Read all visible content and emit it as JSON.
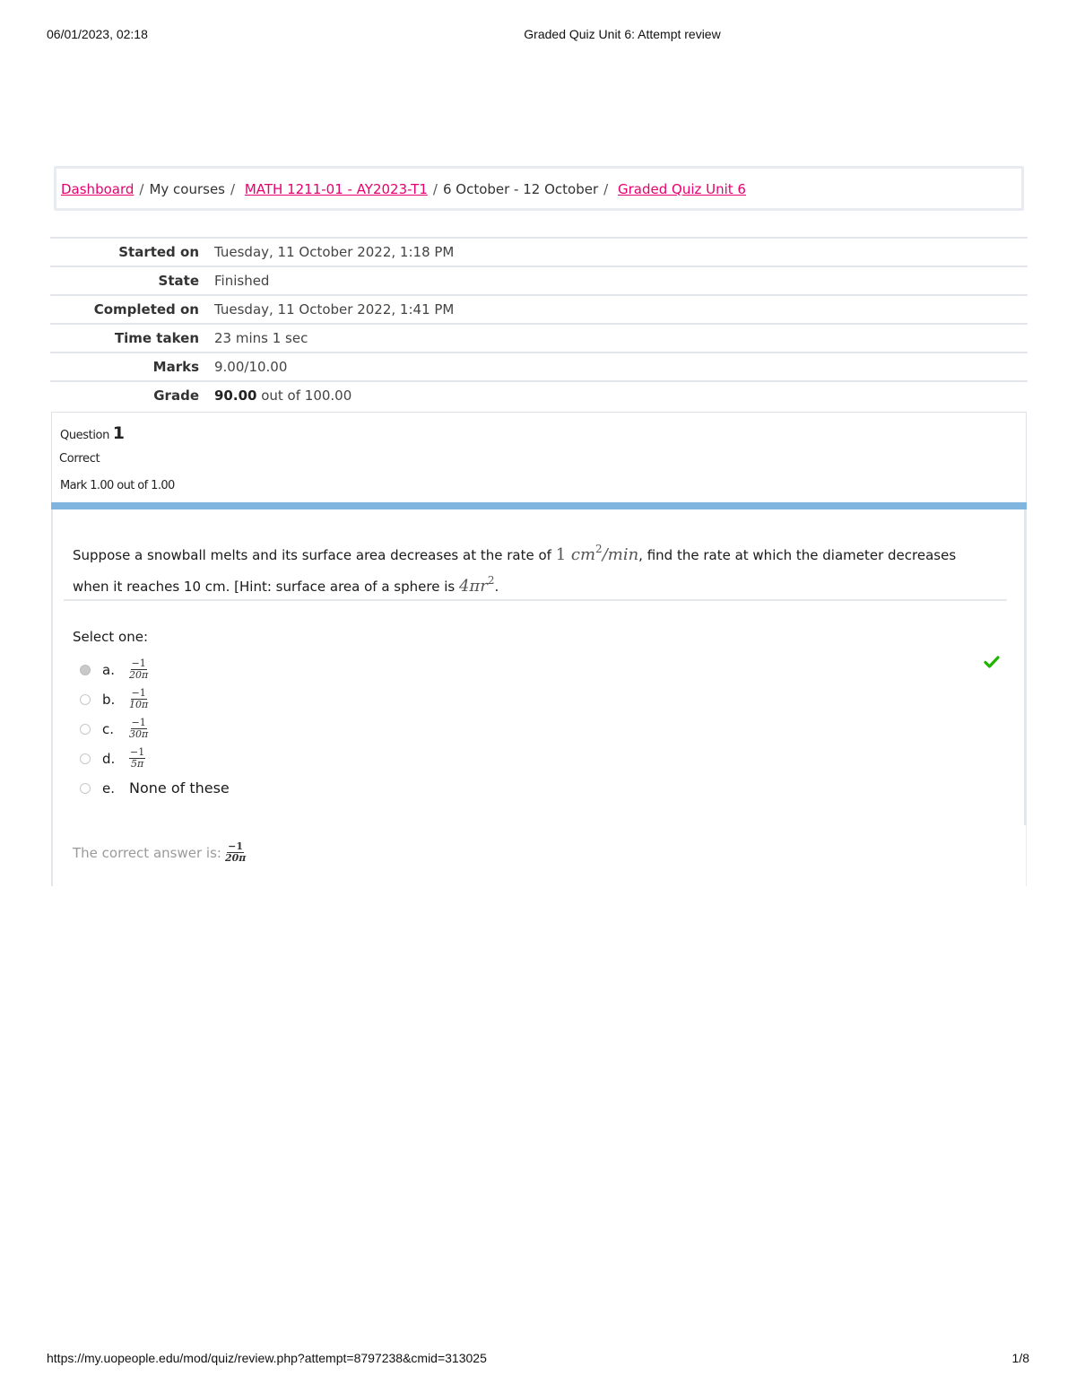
{
  "print_header": {
    "datetime": "06/01/2023, 02:18",
    "title": "Graded Quiz Unit 6: Attempt review"
  },
  "breadcrumb": {
    "items": [
      {
        "label": "Dashboard",
        "link": true
      },
      {
        "label": "My courses",
        "link": false
      },
      {
        "label": "MATH 1211-01 - AY2023-T1",
        "link": true
      },
      {
        "label": "6 October - 12 October",
        "link": false
      },
      {
        "label": "Graded Quiz Unit 6",
        "link": true
      }
    ],
    "separator": "/",
    "link_color": "#e6006f"
  },
  "summary": [
    {
      "label": "Started on",
      "value": "Tuesday, 11 October 2022, 1:18 PM"
    },
    {
      "label": "State",
      "value": "Finished"
    },
    {
      "label": "Completed on",
      "value": "Tuesday, 11 October 2022, 1:41 PM"
    },
    {
      "label": "Time taken",
      "value": "23 mins 1 sec"
    },
    {
      "label": "Marks",
      "value": "9.00/10.00"
    },
    {
      "label": "Grade",
      "value_bold": "90.00",
      "value": " out of 100.00"
    }
  ],
  "question": {
    "label": "Question",
    "number": "1",
    "state": "Correct",
    "grade": "Mark 1.00 out of 1.00",
    "text_part1": "Suppose a snowball melts and its surface area decreases at the rate of ",
    "rate_value": "1",
    "rate_unit": "cm",
    "rate_exp": "2",
    "rate_per": "/min",
    "text_part2": ", find the rate at which the diameter decreases when it reaches 10 cm. [Hint: surface area of a sphere is ",
    "hint_math": "4πr",
    "hint_exp": "2",
    "text_part3": ".",
    "prompt": "Select one:",
    "options": [
      {
        "letter": "a.",
        "numerator": "−1",
        "denominator": "20π",
        "selected": true
      },
      {
        "letter": "b.",
        "numerator": "−1",
        "denominator": "10π",
        "selected": false
      },
      {
        "letter": "c.",
        "numerator": "−1",
        "denominator": "30π",
        "selected": false
      },
      {
        "letter": "d.",
        "numerator": "−1",
        "denominator": "5π",
        "selected": false
      },
      {
        "letter": "e.",
        "text": "None of these",
        "selected": false
      }
    ],
    "correct_icon": "check-icon",
    "correct_color": "#1fb400",
    "feedback_label": "The correct answer is:",
    "feedback_numerator": "−1",
    "feedback_denominator": "20π",
    "accent_bar_color": "#7fb5de"
  },
  "print_footer": {
    "url": "https://my.uopeople.edu/mod/quiz/review.php?attempt=8797238&cmid=313025",
    "page": "1/8"
  }
}
